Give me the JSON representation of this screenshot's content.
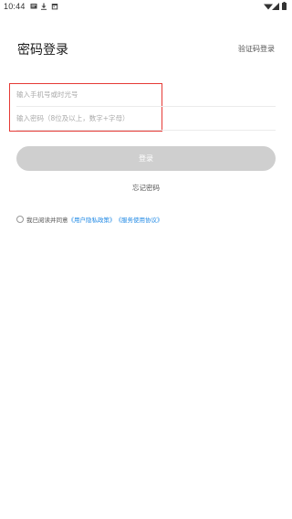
{
  "status_bar": {
    "time": "10:44",
    "icons": [
      "message-icon",
      "download-icon",
      "calendar-icon",
      "wifi-icon",
      "signal-icon",
      "battery-icon"
    ]
  },
  "header": {
    "title": "密码登录",
    "switch_login_label": "验证码登录"
  },
  "form": {
    "phone_placeholder": "输入手机号或时光号",
    "phone_value": "",
    "password_placeholder": "输入密码（8位及以上，数字+字母）",
    "password_value": ""
  },
  "actions": {
    "login_label": "登录",
    "forgot_password_label": "忘记密码"
  },
  "agreement": {
    "checked": false,
    "prefix": "我已阅读并同意",
    "privacy_link": "《用户隐私政策》",
    "service_link": "《服务使用协议》"
  },
  "colors": {
    "highlight_box": "#e53935",
    "login_button_disabled": "#cfcfcf",
    "link": "#1e88e5"
  }
}
